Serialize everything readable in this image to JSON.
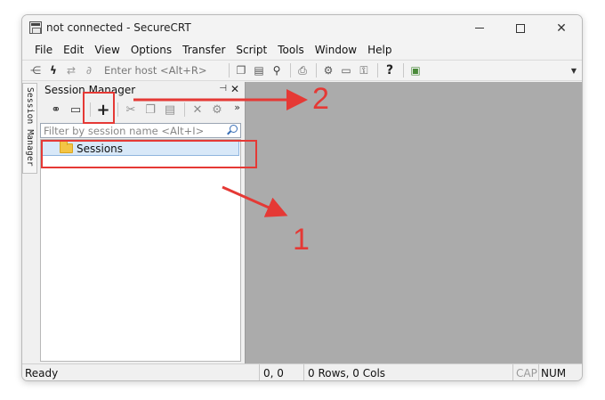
{
  "window": {
    "title": "not connected - SecureCRT"
  },
  "menu": [
    "File",
    "Edit",
    "View",
    "Options",
    "Transfer",
    "Script",
    "Tools",
    "Window",
    "Help"
  ],
  "toolbar": {
    "host_placeholder": "Enter host <Alt+R>",
    "icons": [
      "connect-bar-icon",
      "lightning-icon",
      "reconnect-icon",
      "disconnect-icon",
      "copy-icon",
      "paste-icon",
      "find-icon",
      "print-icon",
      "settings-icon",
      "keymap-icon",
      "sftp-icon",
      "help-icon",
      "screenshot-icon"
    ]
  },
  "side_tab": {
    "label": "Session Manager"
  },
  "session_manager": {
    "title": "Session Manager",
    "pin_glyph": "⊣",
    "close_glyph": "✕",
    "more_glyph": "»",
    "filter_placeholder": "Filter by session name <Alt+I>",
    "tools": [
      "link-icon",
      "terminal-icon",
      "new-session-icon",
      "cut-icon",
      "copy-icon",
      "paste-icon",
      "delete-icon",
      "properties-icon"
    ],
    "tree": [
      {
        "label": "Sessions",
        "icon": "folder-icon"
      }
    ]
  },
  "status": {
    "ready": "Ready",
    "position": "0, 0",
    "size": "0 Rows, 0 Cols",
    "cap": "CAP",
    "num": "NUM"
  },
  "annotations": {
    "labels": [
      "1",
      "2"
    ],
    "color": "#e53935"
  },
  "colors": {
    "workspace": "#ababab",
    "selection": "#d8e8f8",
    "folder": "#f3c445"
  }
}
